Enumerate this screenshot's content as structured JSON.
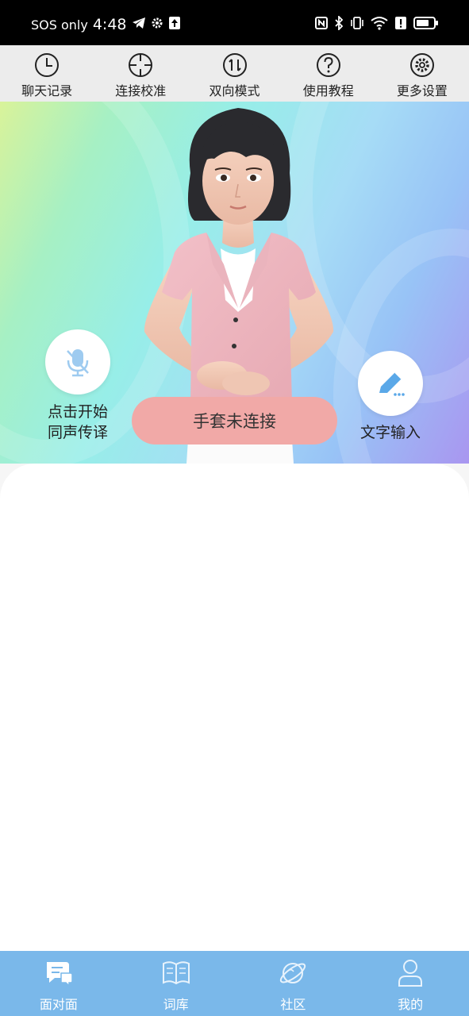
{
  "status_bar": {
    "sos": "SOS only",
    "time": "4:48",
    "left_icons": [
      "telegram-icon",
      "gear-icon",
      "upload-icon"
    ],
    "right_icons": [
      "nfc-icon",
      "bluetooth-icon",
      "vibrate-icon",
      "wifi-icon",
      "alert-icon",
      "battery-icon"
    ]
  },
  "toolbar": {
    "items": [
      {
        "label": "聊天记录",
        "icon": "clock-icon"
      },
      {
        "label": "连接校准",
        "icon": "crosshair-icon"
      },
      {
        "label": "双向模式",
        "icon": "two-way-arrows-icon"
      },
      {
        "label": "使用教程",
        "icon": "question-icon"
      },
      {
        "label": "更多设置",
        "icon": "gear-icon"
      }
    ]
  },
  "hero": {
    "voice_button": {
      "line1": "点击开始",
      "line2": "同声传译",
      "icon": "mic-off-icon"
    },
    "text_button": {
      "label": "文字输入",
      "icon": "pencil-icon"
    },
    "glove_status": "手套未连接"
  },
  "bottom_nav": {
    "items": [
      {
        "label": "面对面",
        "icon": "chat-icon",
        "active": true
      },
      {
        "label": "词库",
        "icon": "book-icon",
        "active": false
      },
      {
        "label": "社区",
        "icon": "planet-icon",
        "active": false
      },
      {
        "label": "我的",
        "icon": "user-icon",
        "active": false
      }
    ]
  },
  "colors": {
    "status_bar": "#000000",
    "toolbar": "#ececec",
    "glove_pill": "#f1a9a7",
    "accent_blue": "#7ab8ea",
    "icon_blue": "#5aa8e8"
  }
}
